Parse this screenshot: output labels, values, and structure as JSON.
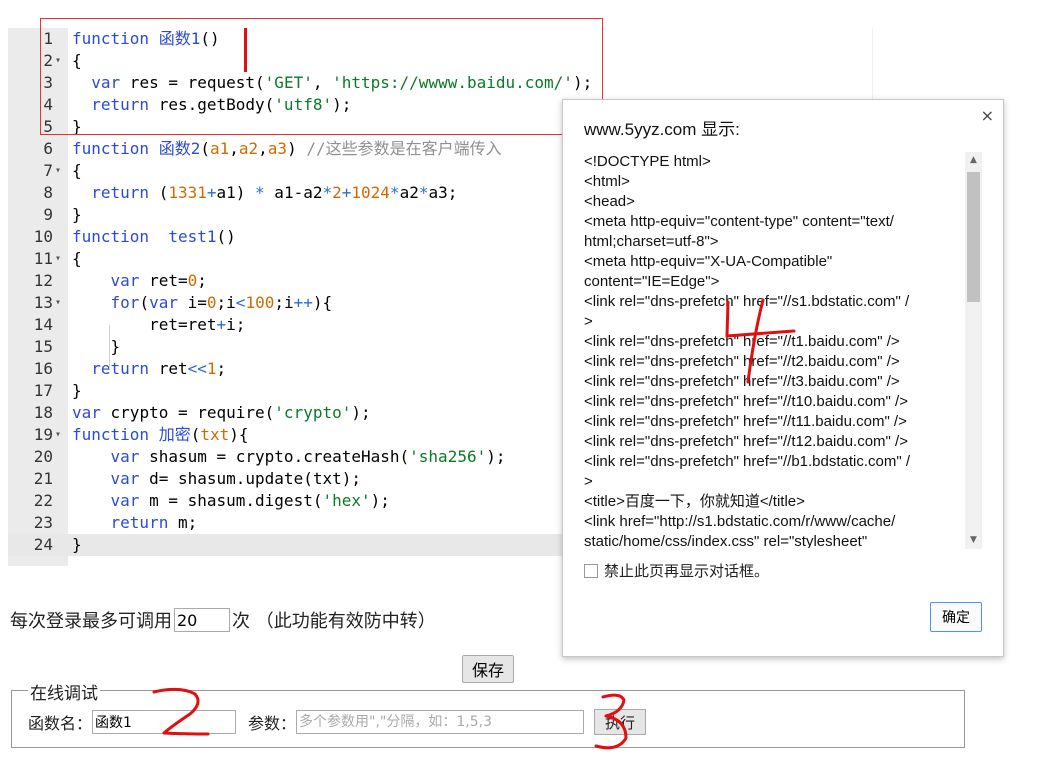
{
  "editor": {
    "lines": [
      {
        "n": "1",
        "fold": "",
        "html": "<span class='kw'>function</span> <span class='fn'>函数1</span>()"
      },
      {
        "n": "2",
        "fold": "▾",
        "html": "{"
      },
      {
        "n": "3",
        "fold": "",
        "html": "  <span class='kw'>var</span> res = request(<span class='str'>'GET'</span>, <span class='str'>'https://wwww.baidu.com/'</span>);"
      },
      {
        "n": "4",
        "fold": "",
        "html": "  <span class='kw'>return</span> res.getBody(<span class='str'>'utf8'</span>);"
      },
      {
        "n": "5",
        "fold": "",
        "html": "}"
      },
      {
        "n": "6",
        "fold": "",
        "html": "<span class='kw'>function</span> <span class='fn'>函数2</span>(<span class='num'>a1</span>,<span class='num'>a2</span>,<span class='num'>a3</span>) <span class='cmt'>//这些参数是在客户端传入</span>"
      },
      {
        "n": "7",
        "fold": "▾",
        "html": "{"
      },
      {
        "n": "8",
        "fold": "",
        "html": "  <span class='kw'>return</span> (<span class='num'>1331</span><span class='op'>+</span>a1) <span class='op'>*</span> a1-a2<span class='op'>*</span><span class='num'>2</span><span class='op'>+</span><span class='num'>1024</span><span class='op'>*</span>a2<span class='op'>*</span>a3;"
      },
      {
        "n": "9",
        "fold": "",
        "html": "}"
      },
      {
        "n": "10",
        "fold": "",
        "html": "<span class='kw'>function</span>  <span class='fn'>test1</span>()"
      },
      {
        "n": "11",
        "fold": "▾",
        "html": "{"
      },
      {
        "n": "12",
        "fold": "",
        "html": "    <span class='kw'>var</span> ret=<span class='num'>0</span>;"
      },
      {
        "n": "13",
        "fold": "▾",
        "html": "    <span class='kw'>for</span>(<span class='kw'>var</span> i=<span class='num'>0</span>;i<span class='op'>&lt;</span><span class='num'>100</span>;i<span class='op'>++</span>){"
      },
      {
        "n": "14",
        "fold": "",
        "html": "        ret=ret<span class='op'>+</span>i;"
      },
      {
        "n": "15",
        "fold": "",
        "html": "    }"
      },
      {
        "n": "16",
        "fold": "",
        "html": "  <span class='kw'>return</span> ret<span class='op'>&lt;&lt;</span><span class='num'>1</span>;"
      },
      {
        "n": "17",
        "fold": "",
        "html": "}"
      },
      {
        "n": "18",
        "fold": "",
        "html": "<span class='kw'>var</span> crypto = require(<span class='str'>'crypto'</span>);"
      },
      {
        "n": "19",
        "fold": "▾",
        "html": "<span class='kw'>function</span> <span class='fn'>加密</span>(<span class='num'>txt</span>){"
      },
      {
        "n": "20",
        "fold": "",
        "html": "    <span class='kw'>var</span> shasum = crypto.createHash(<span class='str'>'sha256'</span>);"
      },
      {
        "n": "21",
        "fold": "",
        "html": "    <span class='kw'>var</span> d= shasum.update(txt);"
      },
      {
        "n": "22",
        "fold": "",
        "html": "    <span class='kw'>var</span> m = shasum.digest(<span class='str'>'hex'</span>);"
      },
      {
        "n": "23",
        "fold": "",
        "html": "    <span class='kw'>return</span> m;"
      },
      {
        "n": "24",
        "fold": "",
        "html": "}"
      }
    ],
    "active_line": "24"
  },
  "login_limit": {
    "prefix": "每次登录最多可调用",
    "value": "20",
    "suffix": "次 （此功能有效防中转）"
  },
  "save_label": "保存",
  "debug": {
    "legend": "在线调试",
    "fn_label": "函数名：",
    "fn_value": "函数1",
    "param_label": "参数：",
    "param_placeholder": "多个参数用\",\"分隔，如：1,5,3",
    "run_label": "执行"
  },
  "dialog": {
    "title": "www.5yyz.com 显示:",
    "close": "×",
    "content_lines": [
      "<!DOCTYPE html>",
      "<html>",
      "<head>",
      "<meta http-equiv=\"content-type\" content=\"text/",
      "html;charset=utf-8\">",
      "<meta http-equiv=\"X-UA-Compatible\"",
      "content=\"IE=Edge\">",
      "<link rel=\"dns-prefetch\" href=\"//s1.bdstatic.com\" /",
      ">",
      "<link rel=\"dns-prefetch\" href=\"//t1.baidu.com\" />",
      "<link rel=\"dns-prefetch\" href=\"//t2.baidu.com\" />",
      "<link rel=\"dns-prefetch\" href=\"//t3.baidu.com\" />",
      "<link rel=\"dns-prefetch\" href=\"//t10.baidu.com\" />",
      "<link rel=\"dns-prefetch\" href=\"//t11.baidu.com\" />",
      "<link rel=\"dns-prefetch\" href=\"//t12.baidu.com\" />",
      "<link rel=\"dns-prefetch\" href=\"//b1.bdstatic.com\" /",
      ">",
      "<title>百度一下，你就知道</title>",
      "<link href=\"http://s1.bdstatic.com/r/www/cache/",
      "static/home/css/index.css\" rel=\"stylesheet\""
    ],
    "suppress_label": "禁止此页再显示对话框。",
    "ok_label": "确定"
  },
  "colors": {
    "annotation_red": "#e01010",
    "keyword": "#2b4bd6",
    "string": "#0b7a28",
    "number": "#d06a00",
    "comment": "#909090",
    "ok_border": "#4d90fe"
  }
}
